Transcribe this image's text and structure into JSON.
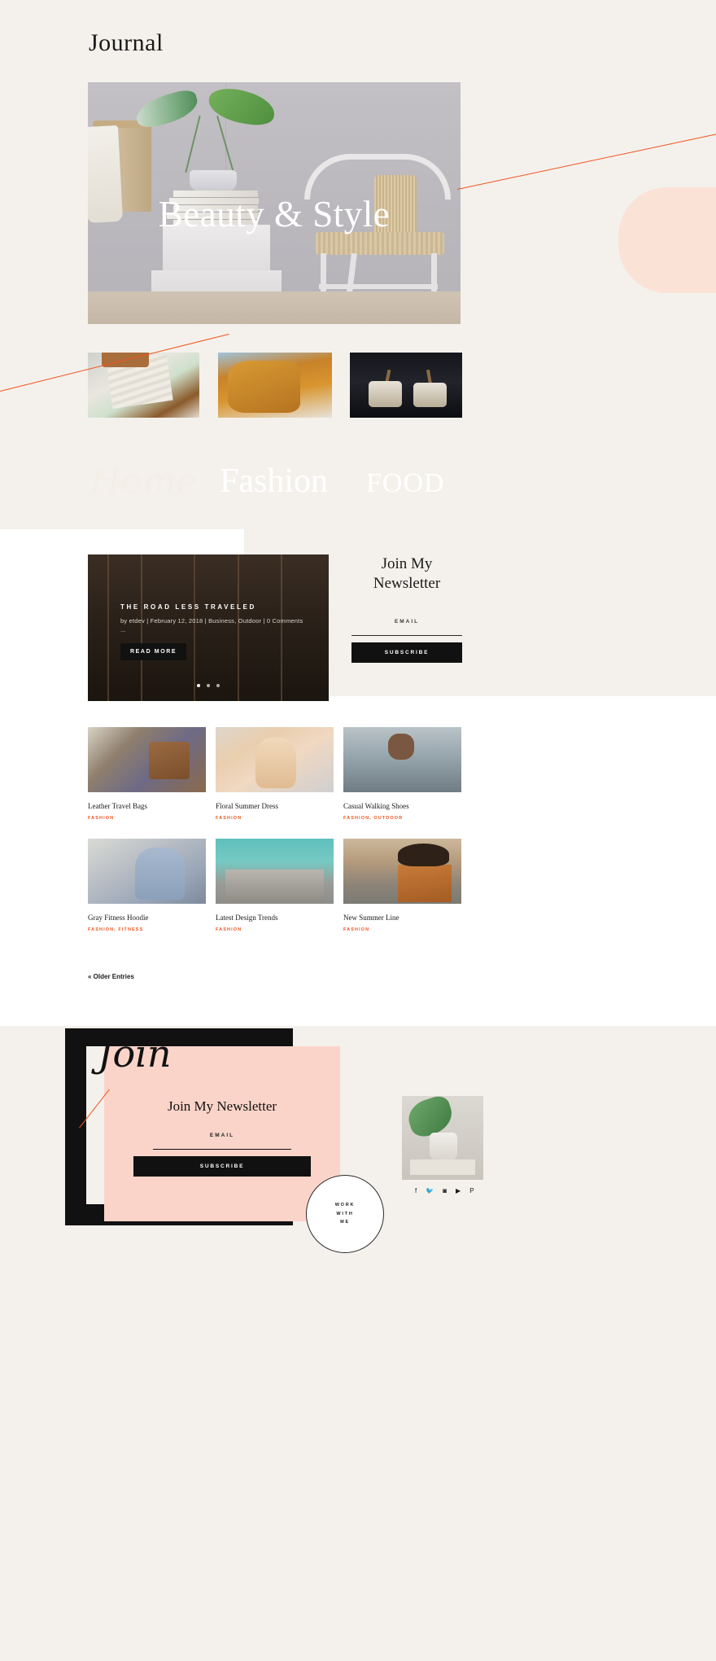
{
  "header": {
    "title": "Journal"
  },
  "hero": {
    "title": "Beauty & Style"
  },
  "categories": [
    {
      "label": "Home",
      "name": "category-home"
    },
    {
      "label": "Fashion",
      "name": "category-fashion"
    },
    {
      "label": "FOOD",
      "name": "category-food"
    }
  ],
  "slider": {
    "post_title": "THE ROAD LESS TRAVELED",
    "meta": "by etdev | February 12, 2018 | Business, Outdoor | 0 Comments",
    "excerpt": "...",
    "read_more": "READ MORE",
    "dots_total": 3,
    "dot_active": 1
  },
  "newsletter_sidebar": {
    "title_line1": "Join My",
    "title_line2": "Newsletter",
    "email_label": "EMAIL",
    "email_value": "",
    "email_placeholder": "",
    "subscribe_label": "SUBSCRIBE"
  },
  "posts": [
    {
      "title": "Leather Travel Bags",
      "category": "FASHION"
    },
    {
      "title": "Floral Summer Dress",
      "category": "FASHION"
    },
    {
      "title": "Casual Walking Shoes",
      "category": "FASHION, OUTDOOR"
    },
    {
      "title": "Gray Fitness Hoodie",
      "category": "FASHION, FITNESS"
    },
    {
      "title": "Latest Design Trends",
      "category": "FASHION"
    },
    {
      "title": "New Summer Line",
      "category": "FASHION"
    }
  ],
  "pagination": {
    "older_entries": "« Older Entries"
  },
  "cta": {
    "script_word": "Join",
    "title": "Join My Newsletter",
    "email_label": "EMAIL",
    "email_value": "",
    "subscribe_label": "SUBSCRIBE",
    "badge_line1": "WORK",
    "badge_line2": "WITH",
    "badge_line3": "ME"
  },
  "social": [
    {
      "name": "facebook-icon",
      "glyph": "f"
    },
    {
      "name": "twitter-icon",
      "glyph": "🐦"
    },
    {
      "name": "instagram-icon",
      "glyph": "◙"
    },
    {
      "name": "youtube-icon",
      "glyph": "▶"
    },
    {
      "name": "pinterest-icon",
      "glyph": "P"
    }
  ],
  "colors": {
    "background": "#f4f1ec",
    "accent": "#f0541e",
    "dark": "#111111",
    "pink": "#fbd4c9"
  }
}
